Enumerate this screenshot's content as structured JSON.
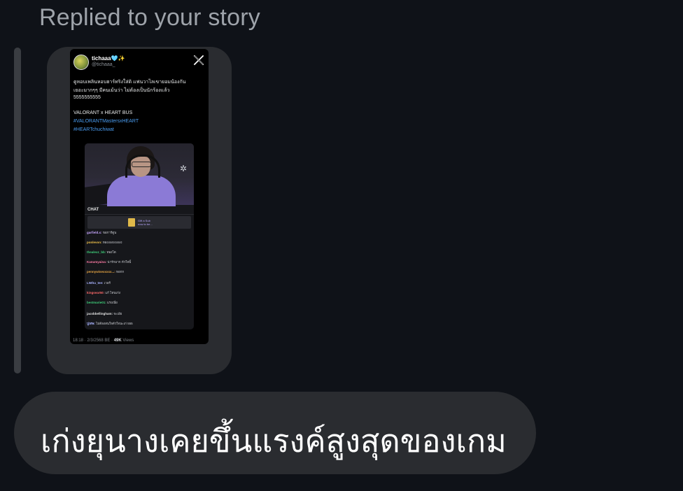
{
  "header": {
    "replied_label": "Replied to your story"
  },
  "story": {
    "tweet": {
      "display_name": "tichaaa🩵✨",
      "handle": "@tichaaa_",
      "text_lines": [
        "ดูหอบเพลินหอบฮาร์ทริงใส่ดิ แฟนวาไลเขายอมน้องกัน",
        "เยอะมากๆๆ มีคนเม้นว่า ไม่ต้องเป็นนักร้องแล้ว",
        "5555555555"
      ],
      "line_title": "VALORANT x HEART BUS",
      "hashtags": [
        "#VALORANTMastersxHEART",
        "#HEARTchuchiwat"
      ],
      "footer_time": "18:18 · 2/3/2568 BE · ",
      "footer_views_count": "49K",
      "footer_views_label": " Views"
    },
    "clip": {
      "chat_label": "CHAT",
      "sub_prompt_line1": "Gift a Sub",
      "sub_prompt_line2": "now to be...",
      "chat_lines": [
        {
          "user": "garfield.x:",
          "msg": " ขอการ์ตูน",
          "color": "#c7a6ff"
        },
        {
          "user": "ponlevon:",
          "msg": " ทองงงงงงงงงง",
          "color": "#f0c24a"
        },
        {
          "user": "thealexz_bb:",
          "msg": " ทองโต",
          "color": "#3fd07a"
        },
        {
          "user": "Kanumyaina:",
          "msg": " น่ารักมาก หัวใจนี้",
          "color": "#ff7ba6"
        },
        {
          "user": "pennywisexxxxx...:",
          "msg": " หอกก",
          "color": "#e8a642"
        },
        {
          "user": "LNthu_tee:",
          "msg": " เวอร์",
          "color": "#a9b3ff"
        },
        {
          "user": "kingsear50:",
          "msg": " แก้ ไหนเก่ง",
          "color": "#ff6a6a"
        },
        {
          "user": "bestmarie01:",
          "msg": " แรงเนี่ย",
          "color": "#3fd07a"
        },
        {
          "user": "jacobbellingham:",
          "msg": " จะเอ้ย",
          "color": "#e6e6e6"
        },
        {
          "user": "ปูเทพ:",
          "msg": " ไม่ต้องสนใจตัวใจนะเก่ 555",
          "color": "#a9b3ff"
        }
      ]
    }
  },
  "message": {
    "text": "เก่งยุนางเคยขึ้นแรงค์สูงสุดของเกม"
  },
  "colors": {
    "background": "#0f1218",
    "bubble": "#2a2c30",
    "link": "#4a9cf0"
  },
  "icons": {
    "brand": "x-logo-icon"
  }
}
